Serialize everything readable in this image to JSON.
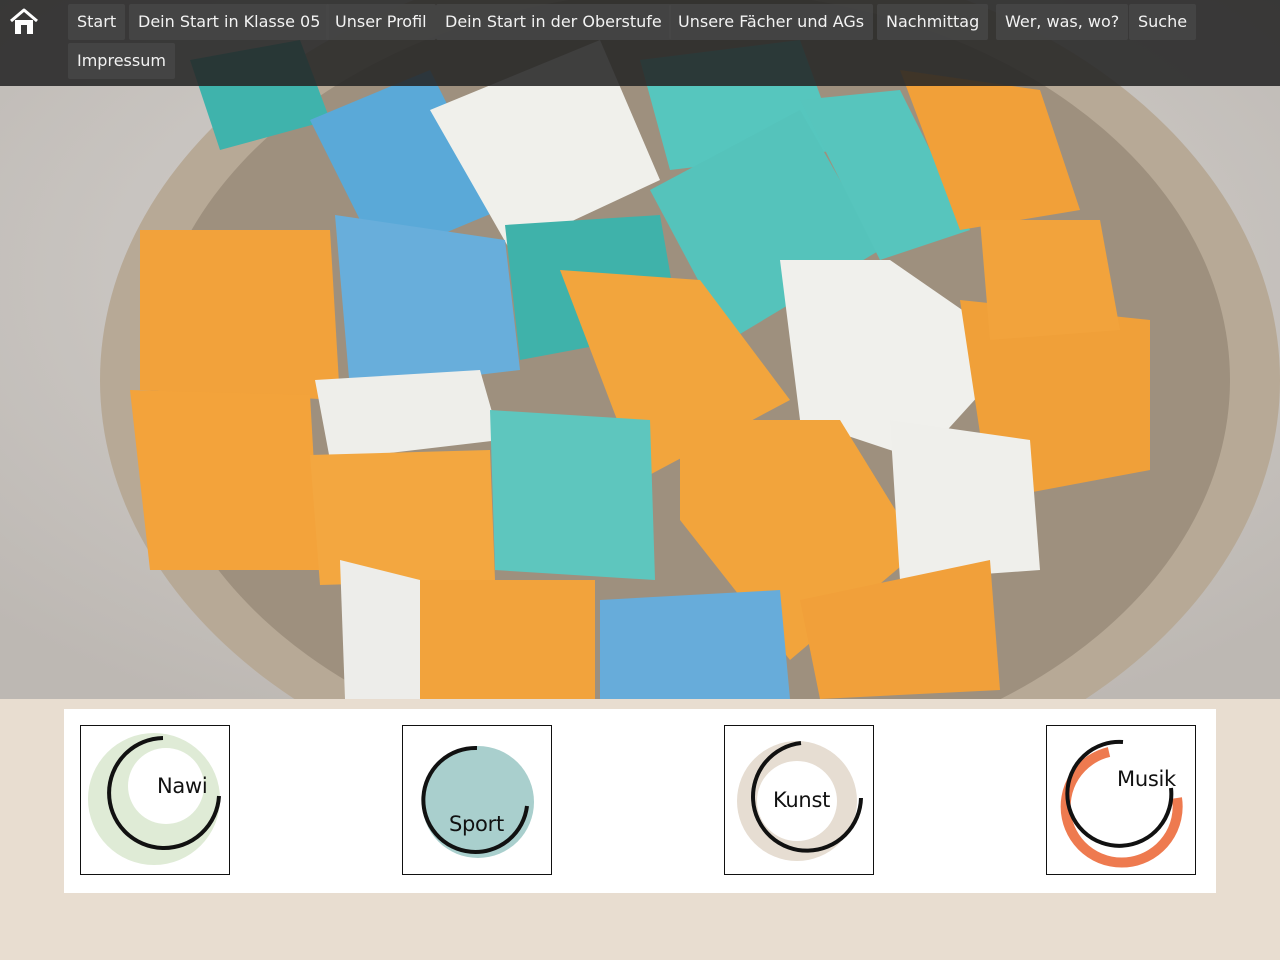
{
  "nav": {
    "home_icon": "home-icon",
    "items": [
      {
        "label": "Start"
      },
      {
        "label": "Dein Start in Klasse 05"
      },
      {
        "label": "Unser Profil"
      },
      {
        "label": "Dein Start in der Oberstufe"
      },
      {
        "label": "Unsere Fächer und AGs"
      },
      {
        "label": "Nachmittag"
      },
      {
        "label": "Wer, was, wo?"
      },
      {
        "label": "Suche"
      },
      {
        "label": "Impressum"
      }
    ]
  },
  "profile_cards": [
    {
      "label": "Nawi",
      "color": "#dfebd6"
    },
    {
      "label": "Sport",
      "color": "#a9cfcd"
    },
    {
      "label": "Kunst",
      "color": "#e6ddd2"
    },
    {
      "label": "Musik",
      "color": "#ee7a4f"
    }
  ],
  "colors": {
    "nav_bg": "#262626",
    "page_bg": "#e8ddd0",
    "brick_orange": "#f0a33a",
    "brick_teal": "#5ec8c0",
    "brick_blue": "#6ab0db",
    "brick_white": "#eeeeea"
  }
}
